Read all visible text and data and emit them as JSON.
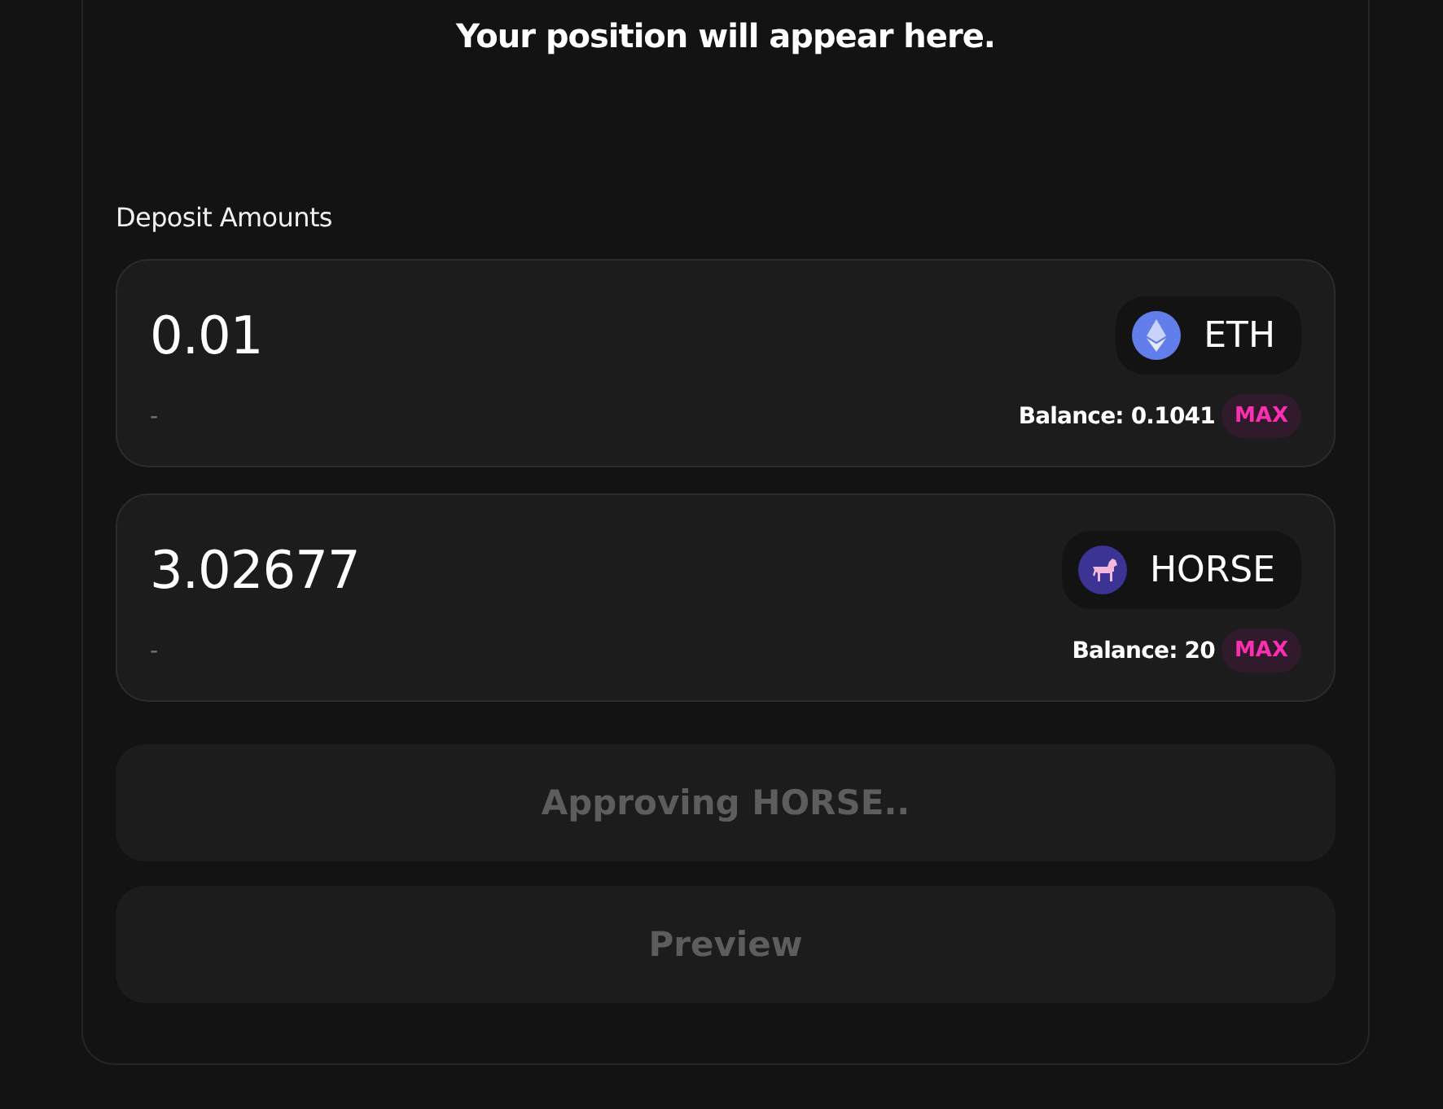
{
  "heading": "Your position will appear here.",
  "deposit": {
    "label": "Deposit Amounts",
    "inputs": [
      {
        "amount": "0.01",
        "token": {
          "symbol": "ETH",
          "kind": "eth"
        },
        "usd": "-",
        "balance": "Balance: 0.1041",
        "max": "MAX"
      },
      {
        "amount": "3.02677",
        "token": {
          "symbol": "HORSE",
          "kind": "horse"
        },
        "usd": "-",
        "balance": "Balance: 20",
        "max": "MAX"
      }
    ]
  },
  "buttons": [
    {
      "label": "Approving HORSE..",
      "disabled": true
    },
    {
      "label": "Preview",
      "disabled": true
    }
  ]
}
